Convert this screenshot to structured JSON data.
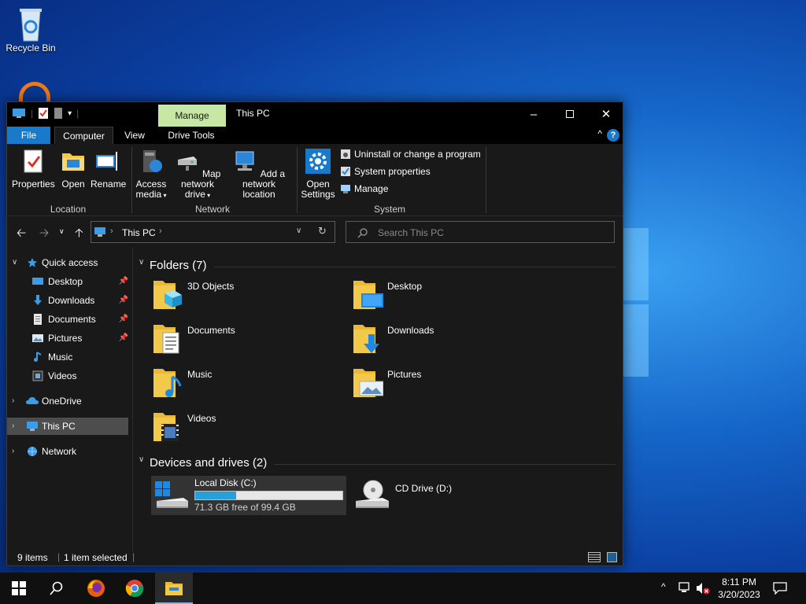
{
  "desktop": {
    "recycle_bin_label": "Recycle Bin"
  },
  "window": {
    "title": "This PC",
    "context_tab": "Manage",
    "tabs": [
      "File",
      "Computer",
      "View",
      "Drive Tools"
    ],
    "help_symbol": "?"
  },
  "ribbon": {
    "location": {
      "label": "Location",
      "properties": "Properties",
      "open": "Open",
      "rename": "Rename"
    },
    "network": {
      "label": "Network",
      "access_media_1": "Access",
      "access_media_2": "media",
      "map_drive_1": "Map network",
      "map_drive_2": "drive",
      "add_location_1": "Add a network",
      "add_location_2": "location"
    },
    "system": {
      "label": "System",
      "open_settings_1": "Open",
      "open_settings_2": "Settings",
      "uninstall": "Uninstall or change a program",
      "system_properties": "System properties",
      "manage": "Manage"
    }
  },
  "address": {
    "path": "This PC",
    "search_placeholder": "Search This PC"
  },
  "nav": {
    "quick_access": "Quick access",
    "items": [
      {
        "label": "Desktop"
      },
      {
        "label": "Downloads"
      },
      {
        "label": "Documents"
      },
      {
        "label": "Pictures"
      },
      {
        "label": "Music"
      },
      {
        "label": "Videos"
      }
    ],
    "onedrive": "OneDrive",
    "this_pc": "This PC",
    "network": "Network"
  },
  "content": {
    "folders_header": "Folders (7)",
    "folders": [
      "3D Objects",
      "Desktop",
      "Documents",
      "Downloads",
      "Music",
      "Pictures",
      "Videos"
    ],
    "drives_header": "Devices and drives (2)",
    "drive_c": {
      "name": "Local Disk (C:)",
      "free": "71.3 GB free of 99.4 GB",
      "used_fraction": 0.28
    },
    "drive_d": {
      "name": "CD Drive (D:)"
    }
  },
  "status": {
    "items": "9 items",
    "selected": "1 item selected"
  },
  "taskbar": {
    "time": "8:11 PM",
    "date": "3/20/2023"
  },
  "colors": {
    "accent": "#1979ca",
    "manage_tab": "#c7e7a4",
    "folder": "#f3c94b",
    "bar_fill": "#26a0da"
  }
}
